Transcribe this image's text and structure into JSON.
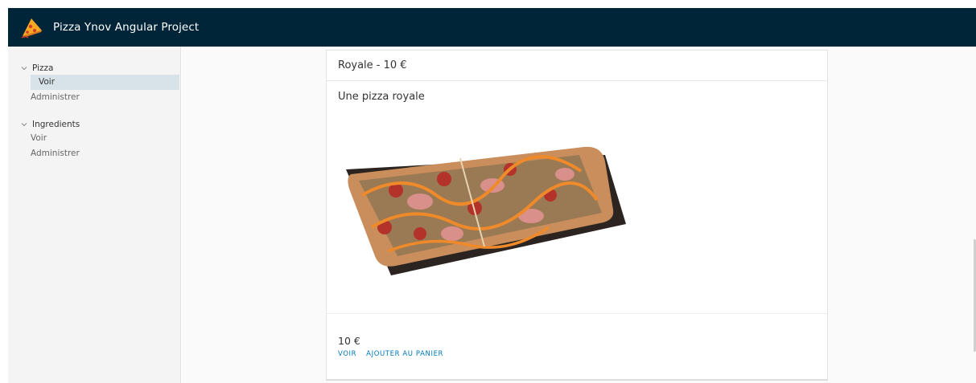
{
  "header": {
    "title": "Pizza Ynov Angular Project"
  },
  "sidebar": {
    "groups": [
      {
        "label": "Pizza",
        "items": [
          {
            "label": "Voir",
            "active": true
          },
          {
            "label": "Administrer"
          }
        ]
      },
      {
        "label": "Ingredients",
        "items": [
          {
            "label": "Voir"
          },
          {
            "label": "Administrer"
          }
        ]
      }
    ]
  },
  "card": {
    "title": "Royale - 10 €",
    "description": "Une pizza royale",
    "price": "10 €",
    "actions": {
      "view": "Voir",
      "add_to_cart": "Ajouter au panier"
    }
  },
  "colors": {
    "header_bg": "#002538",
    "link": "#0079b8",
    "active_nav_bg": "#d8e3e9"
  },
  "icons": {
    "logo": "pizza-slice-icon",
    "expand": "chevron-down-icon"
  }
}
